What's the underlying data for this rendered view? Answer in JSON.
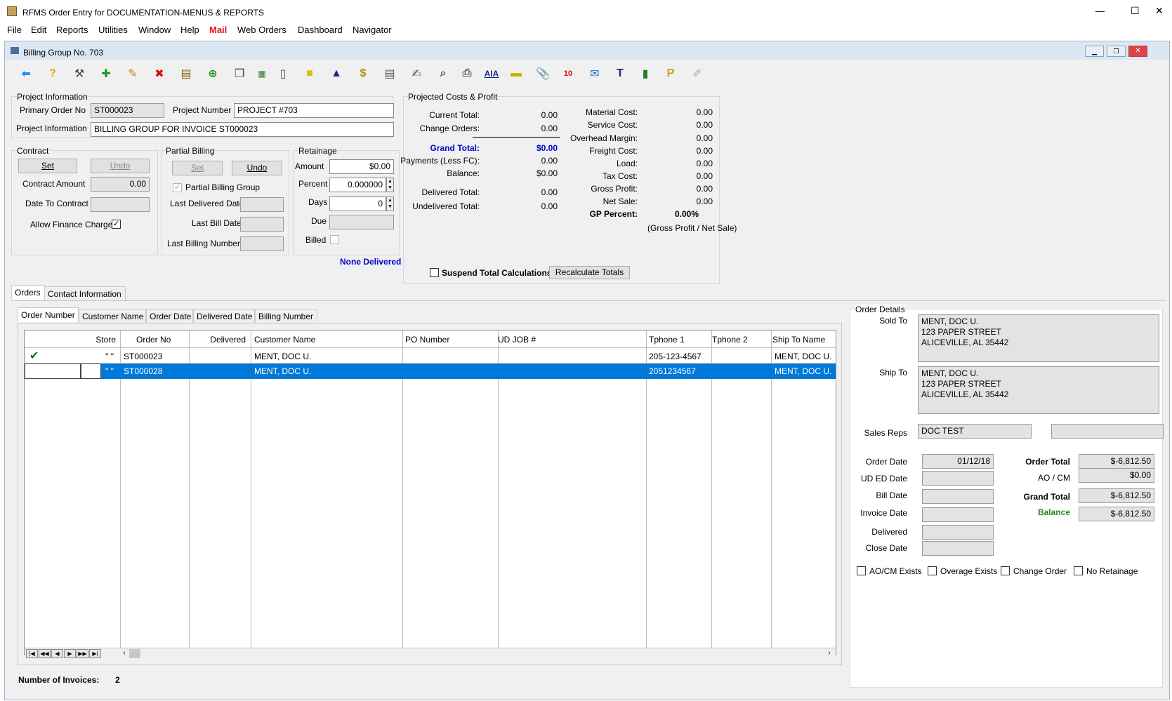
{
  "window": {
    "title": "RFMS Order Entry for DOCUMENTATION-MENUS & REPORTS",
    "min": "—",
    "max": "☐",
    "close": "✕"
  },
  "menu": [
    "File",
    "Edit",
    "Reports",
    "Utilities",
    "Window",
    "Help",
    "Mail",
    "Web Orders",
    "Dashboard",
    "Navigator"
  ],
  "child": {
    "title": "Billing Group No. 703"
  },
  "project": {
    "section": "Project Information",
    "primary_order_label": "Primary Order No",
    "primary_order_value": "ST000023",
    "project_number_label": "Project Number",
    "project_number_value": "PROJECT #703",
    "info_label": "Project Information",
    "info_value": "BILLING GROUP FOR INVOICE ST000023"
  },
  "contract": {
    "section": "Contract",
    "set": "Set",
    "undo": "Undo",
    "amount_label": "Contract Amount",
    "amount_value": "0.00",
    "date_label": "Date To Contract",
    "date_value": "",
    "finance_label": "Allow Finance Charge",
    "finance_checked": "✓"
  },
  "partial": {
    "section": "Partial Billing",
    "set": "Set",
    "undo": "Undo",
    "group_label": "Partial Billing Group",
    "group_checked": "✓",
    "last_delivered": "Last Delivered Date",
    "last_bill": "Last Bill Date",
    "last_billing_number": "Last Billing Number"
  },
  "retainage": {
    "section": "Retainage",
    "amount_label": "Amount",
    "amount_value": "$0.00",
    "percent_label": "Percent",
    "percent_value": "0.000000",
    "days_label": "Days",
    "days_value": "0",
    "due_label": "Due",
    "billed_label": "Billed"
  },
  "none_delivered": "None Delivered",
  "projected": {
    "section": "Projected Costs & Profit",
    "current_total_label": "Current Total:",
    "current_total": "0.00",
    "change_orders_label": "Change Orders:",
    "change_orders": "0.00",
    "grand_total_label": "Grand Total:",
    "grand_total": "$0.00",
    "payments_label": "Payments (Less FC):",
    "payments": "0.00",
    "balance_label": "Balance:",
    "balance": "$0.00",
    "delivered_label": "Delivered Total:",
    "delivered": "0.00",
    "undelivered_label": "Undelivered Total:",
    "undelivered": "0.00",
    "material_label": "Material Cost:",
    "material": "0.00",
    "service_label": "Service Cost:",
    "service": "0.00",
    "overhead_label": "Overhead Margin:",
    "overhead": "0.00",
    "freight_label": "Freight Cost:",
    "freight": "0.00",
    "load_label": "Load:",
    "load": "0.00",
    "tax_label": "Tax Cost:",
    "tax": "0.00",
    "gross_label": "Gross Profit:",
    "gross": "0.00",
    "net_label": "Net Sale:",
    "net": "0.00",
    "gp_label": "GP Percent:",
    "gp": "0.00%",
    "gp_note": "(Gross Profit / Net Sale)",
    "suspend_label": "Suspend Total Calculations",
    "recalc": "Recalculate Totals"
  },
  "tabs": {
    "orders": "Orders",
    "contact": "Contact Information"
  },
  "subtabs": [
    "Order Number",
    "Customer Name",
    "Order Date",
    "Delivered Date",
    "Billing Number"
  ],
  "grid": {
    "headers": [
      "Store",
      "Order No",
      "Delivered",
      "Customer Name",
      "PO Number",
      "UD JOB #",
      "Tphone 1",
      "Tphone 2",
      "Ship To Name"
    ],
    "rows": [
      {
        "check": "✔",
        "store": "\" \"",
        "order_no": "ST000023",
        "delivered": "",
        "customer": "MENT, DOC U.",
        "po": "",
        "udjob": "",
        "tphone1": "205-123-4567",
        "tphone2": "",
        "ship_to": "MENT, DOC U."
      },
      {
        "check": "",
        "store": "\" \"",
        "order_no": "ST000028",
        "delivered": "",
        "customer": "MENT, DOC U.",
        "po": "",
        "udjob": "",
        "tphone1": "2051234567",
        "tphone2": "",
        "ship_to": "MENT, DOC U."
      }
    ]
  },
  "invoices": {
    "label": "Number of Invoices:",
    "count": "2"
  },
  "details": {
    "section": "Order Details",
    "sold_to_label": "Sold To",
    "sold_to": [
      "MENT, DOC U.",
      "123 PAPER STREET",
      "ALICEVILLE, AL  35442"
    ],
    "ship_to_label": "Ship To",
    "ship_to": [
      "MENT, DOC U.",
      "123 PAPER STREET",
      "ALICEVILLE, AL  35442"
    ],
    "sales_reps_label": "Sales Reps",
    "sales_rep1": "DOC TEST",
    "sales_rep2": "",
    "order_date_label": "Order Date",
    "order_date": "01/12/18",
    "ud_ed_label": "UD ED Date",
    "bill_date_label": "Bill Date",
    "invoice_date_label": "Invoice Date",
    "delivered_label": "Delivered",
    "close_date_label": "Close Date",
    "order_total_label": "Order Total",
    "order_total": "$-6,812.50",
    "aocm_label": "AO / CM",
    "aocm": "$0.00",
    "grand_total_label": "Grand Total",
    "grand_total": "$-6,812.50",
    "balance_label": "Balance",
    "balance": "$-6,812.50",
    "flags": [
      "AO/CM Exists",
      "Overage Exists",
      "Change Order",
      "No Retainage"
    ]
  },
  "colors": {
    "accent": "#0078d7",
    "blue_text": "#0000cc",
    "green_text": "#1a8a1a",
    "mail_red": "#e81123"
  }
}
